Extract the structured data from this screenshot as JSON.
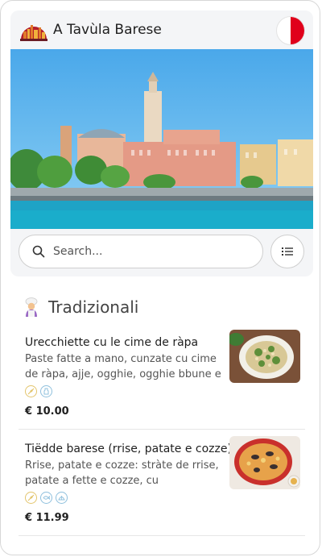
{
  "header": {
    "title": "A Tavùla Barese",
    "language_flag": "flag-icon"
  },
  "search": {
    "placeholder": "Search..."
  },
  "section": {
    "title": "Tradizionali",
    "icon": "chef-icon"
  },
  "items": [
    {
      "name": "Urecchiette cu le cime de ràpa",
      "description": "Paste fatte a mano, cunzate cu cime de ràpa, ajje, ogghie, ogghie bbune e nu...",
      "price": "€ 10.00",
      "badges": [
        "wheat-icon",
        "milk-icon"
      ]
    },
    {
      "name": "Tiëdde barese (rrise, patate e cozze)",
      "description": "Rrise, patate e cozze: stràte de rrise, patate a fette e cozze, cu puomodore,...",
      "price": "€ 11.99",
      "badges": [
        "wheat-icon",
        "fish-icon",
        "shellfish-icon"
      ]
    }
  ],
  "colors": {
    "accent_red": "#e0001b",
    "sea": "#1ea3c6",
    "sky": "#5ab6ee",
    "badge_yellow": "#e3c56d",
    "badge_blue": "#8fc0dd"
  }
}
